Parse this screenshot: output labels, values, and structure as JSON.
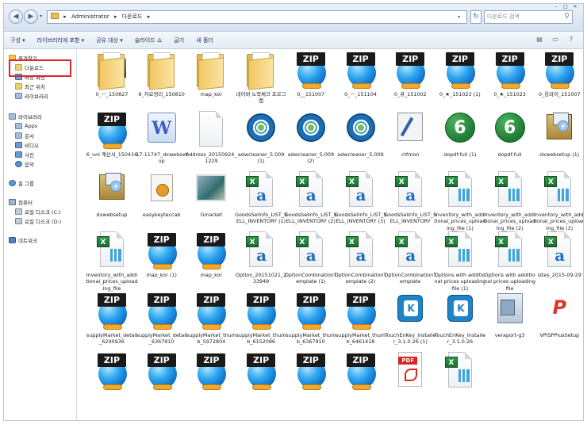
{
  "window": {
    "breadcrumb": [
      "Administrator",
      "다운로드"
    ],
    "search_placeholder": "다운로드 검색"
  },
  "toolbar": {
    "items": [
      "구성 ▾",
      "라이브러리에 포함 ▾",
      "공유 대상 ▾",
      "슬라이드 쇼",
      "굽기",
      "새 폴더"
    ]
  },
  "sidebar": {
    "favorites_label": "즐겨찾기",
    "favorites": [
      "다운로드",
      "바탕 화면",
      "최근 위치",
      "라이브러리"
    ],
    "libraries_label": "라이브러리",
    "libraries": [
      "Apps",
      "문서",
      "비디오",
      "사진",
      "음악"
    ],
    "homegroup_label": "홈 그룹",
    "computer_label": "컴퓨터",
    "drives": [
      "로컬 디스크 (C:)",
      "로컬 디스크 (D:)"
    ],
    "network_label": "네트워크"
  },
  "files": [
    {
      "name": "0_ㅡ_150827",
      "type": "folder-photo"
    },
    {
      "name": "6_자료정리_150810",
      "type": "folder"
    },
    {
      "name": "map_kor",
      "type": "folder"
    },
    {
      "name": "네이버 노락체크 프로그램",
      "type": "folder-doc"
    },
    {
      "name": "0__151007",
      "type": "zip"
    },
    {
      "name": "0_ㅡ_151104",
      "type": "zip"
    },
    {
      "name": "0_큐_151002",
      "type": "zip"
    },
    {
      "name": "0_★_151023 (1)",
      "type": "zip"
    },
    {
      "name": "0_★_151023",
      "type": "zip"
    },
    {
      "name": "0_웅라이_151007",
      "type": "zip"
    },
    {
      "name": "6_uni 계산서_150416",
      "type": "zip"
    },
    {
      "name": "17-11747_dxwebsetup",
      "type": "w-setup"
    },
    {
      "name": "Address_20150924_1229",
      "type": "blank"
    },
    {
      "name": "adwcleaner_5.009 (1)",
      "type": "adw"
    },
    {
      "name": "adwcleaner_5.009 (2)",
      "type": "adw"
    },
    {
      "name": "adwcleaner_5.009",
      "type": "adw"
    },
    {
      "name": "ctfmon",
      "type": "ctf"
    },
    {
      "name": "dopdf-full (1)",
      "type": "dopdf"
    },
    {
      "name": "dopdf-full",
      "type": "dopdf"
    },
    {
      "name": "dxwebsetup (1)",
      "type": "box"
    },
    {
      "name": "dxwebsetup",
      "type": "box"
    },
    {
      "name": "easykeyteccab",
      "type": "easy"
    },
    {
      "name": "Gmarket",
      "type": "gm"
    },
    {
      "name": "GoodsSelInfo_LIST_SELL_INVENTORY (1)",
      "type": "xl-csv"
    },
    {
      "name": "GoodsSelInfo_LIST_SELL_INVENTORY (2)",
      "type": "xl-csv"
    },
    {
      "name": "GoodsSelInfo_LIST_SELL_INVENTORY (3)",
      "type": "xl-csv"
    },
    {
      "name": "GoodsSelInfo_LIST_SELL_INVENTORY",
      "type": "xl-csv"
    },
    {
      "name": "Inventory_with_additional_prices_uploading_file (1)",
      "type": "xl"
    },
    {
      "name": "Inventory_with_additional_prices_uploading_file (2)",
      "type": "xl"
    },
    {
      "name": "Inventory_with_additional_prices_uploading_file (3)",
      "type": "xl"
    },
    {
      "name": "Inventory_with_additional_prices_uploading_file",
      "type": "xl"
    },
    {
      "name": "map_kor (1)",
      "type": "zip"
    },
    {
      "name": "map_kor",
      "type": "zip"
    },
    {
      "name": "Option_20151021_233949",
      "type": "xl-csv"
    },
    {
      "name": "OptionCombinationTemplate (1)",
      "type": "xl-csv"
    },
    {
      "name": "OptionCombinationTemplate (2)",
      "type": "xl-csv"
    },
    {
      "name": "OptionCombinationTemplate",
      "type": "xl-csv"
    },
    {
      "name": "Options with additional prices uploading file (1)",
      "type": "xl"
    },
    {
      "name": "Options with additional prices uploading file",
      "type": "xl"
    },
    {
      "name": "sites_2015-09-29",
      "type": "xl-csv"
    },
    {
      "name": "supplyMarket_detail_6240936",
      "type": "zip"
    },
    {
      "name": "supplyMarket_detail_6367910",
      "type": "zip"
    },
    {
      "name": "supplyMarket_thumb_5972804",
      "type": "zip"
    },
    {
      "name": "supplyMarket_thumb_6152086",
      "type": "zip"
    },
    {
      "name": "supplyMarket_thumb_6367910",
      "type": "zip"
    },
    {
      "name": "supplyMarket_thumb_6461418",
      "type": "zip"
    },
    {
      "name": "TouchEnKey_Installer_3.1.0.26 (1)",
      "type": "tk"
    },
    {
      "name": "TouchEnKey_Installer_3.1.0.26",
      "type": "tk"
    },
    {
      "name": "veraport-g3",
      "type": "vera"
    },
    {
      "name": "VPISPPlusSetup",
      "type": "vpi"
    },
    {
      "name": "",
      "type": "zip"
    },
    {
      "name": "",
      "type": "zip"
    },
    {
      "name": "",
      "type": "zip"
    },
    {
      "name": "",
      "type": "zip"
    },
    {
      "name": "",
      "type": "zip"
    },
    {
      "name": "",
      "type": "zip"
    },
    {
      "name": "",
      "type": "pdf"
    },
    {
      "name": "",
      "type": "xl"
    }
  ],
  "icons": {
    "zip_tag": "ZIP",
    "excel_badge": "X",
    "excel_csv_letter": "a",
    "pdf_badge": "PDF",
    "setup_letter": "W",
    "dopdf_letter": "6",
    "touchenkey_letter": "K",
    "vpi_letter": "P"
  },
  "colors": {
    "highlight_box": "#e0242b",
    "zip_globe": "#2ea6ef",
    "excel_green": "#1c6d31",
    "pdf_red": "#d8261f"
  }
}
